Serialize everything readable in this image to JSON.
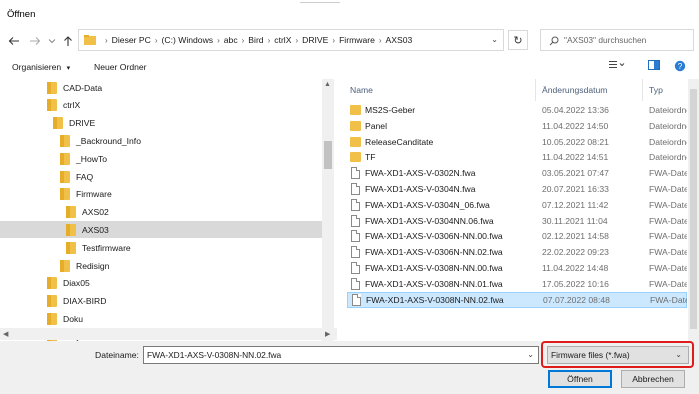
{
  "window": {
    "title": "Öffnen"
  },
  "address": {
    "crumbs": [
      "Dieser PC",
      "(C:) Windows",
      "abc",
      "Bird",
      "ctrlX",
      "DRIVE",
      "Firmware",
      "AXS03"
    ]
  },
  "search": {
    "placeholder": "\"AXS03\" durchsuchen"
  },
  "toolbar": {
    "organize": "Organisieren",
    "new_folder": "Neuer Ordner"
  },
  "tree": [
    {
      "label": "CAD-Data",
      "indent": 0
    },
    {
      "label": "ctrlX",
      "indent": 0
    },
    {
      "label": "DRIVE",
      "indent": 1
    },
    {
      "label": "_Backround_Info",
      "indent": 2
    },
    {
      "label": "_HowTo",
      "indent": 2
    },
    {
      "label": "FAQ",
      "indent": 2
    },
    {
      "label": "Firmware",
      "indent": 2
    },
    {
      "label": "AXS02",
      "indent": 3
    },
    {
      "label": "AXS03",
      "indent": 3,
      "selected": true
    },
    {
      "label": "Testfirmware",
      "indent": 3
    },
    {
      "label": "Redisign",
      "indent": 2
    },
    {
      "label": "Diax05",
      "indent": 0
    },
    {
      "label": "DIAX-BIRD",
      "indent": 0
    },
    {
      "label": "Doku",
      "indent": 0
    },
    {
      "label": "FAQ",
      "indent": 0
    }
  ],
  "columns": {
    "name": "Name",
    "date": "Änderungsdatum",
    "type": "Typ"
  },
  "files": [
    {
      "name": "MS2S-Geber",
      "date": "05.04.2022 13:36",
      "type": "Dateiordner",
      "kind": "folder"
    },
    {
      "name": "Panel",
      "date": "11.04.2022 14:50",
      "type": "Dateiordner",
      "kind": "folder"
    },
    {
      "name": "ReleaseCanditate",
      "date": "10.05.2022 08:21",
      "type": "Dateiordner",
      "kind": "folder"
    },
    {
      "name": "TF",
      "date": "11.04.2022 14:51",
      "type": "Dateiordner",
      "kind": "folder"
    },
    {
      "name": "FWA-XD1-AXS-V-0302N.fwa",
      "date": "03.05.2021 07:47",
      "type": "FWA-Datei",
      "kind": "file"
    },
    {
      "name": "FWA-XD1-AXS-V-0304N.fwa",
      "date": "20.07.2021 16:33",
      "type": "FWA-Datei",
      "kind": "file"
    },
    {
      "name": "FWA-XD1-AXS-V-0304N_06.fwa",
      "date": "07.12.2021 11:42",
      "type": "FWA-Datei",
      "kind": "file"
    },
    {
      "name": "FWA-XD1-AXS-V-0304NN.06.fwa",
      "date": "30.11.2021 11:04",
      "type": "FWA-Datei",
      "kind": "file"
    },
    {
      "name": "FWA-XD1-AXS-V-0306N-NN.00.fwa",
      "date": "02.12.2021 14:58",
      "type": "FWA-Datei",
      "kind": "file"
    },
    {
      "name": "FWA-XD1-AXS-V-0306N-NN.02.fwa",
      "date": "22.02.2022 09:23",
      "type": "FWA-Datei",
      "kind": "file"
    },
    {
      "name": "FWA-XD1-AXS-V-0308N-NN.00.fwa",
      "date": "11.04.2022 14:48",
      "type": "FWA-Datei",
      "kind": "file"
    },
    {
      "name": "FWA-XD1-AXS-V-0308N-NN.01.fwa",
      "date": "17.05.2022 10:16",
      "type": "FWA-Datei",
      "kind": "file"
    },
    {
      "name": "FWA-XD1-AXS-V-0308N-NN.02.fwa",
      "date": "07.07.2022 08:48",
      "type": "FWA-Datei",
      "kind": "file",
      "selected": true
    }
  ],
  "bottom": {
    "filename_label": "Dateiname:",
    "filename_value": "FWA-XD1-AXS-V-0308N-NN.02.fwa",
    "filetype": "Firmware files (*.fwa)",
    "open": "Öffnen",
    "cancel": "Abbrechen"
  },
  "colors": {
    "highlight": "#e01b1b",
    "selection": "#cce8ff",
    "folder": "#f0c048"
  }
}
